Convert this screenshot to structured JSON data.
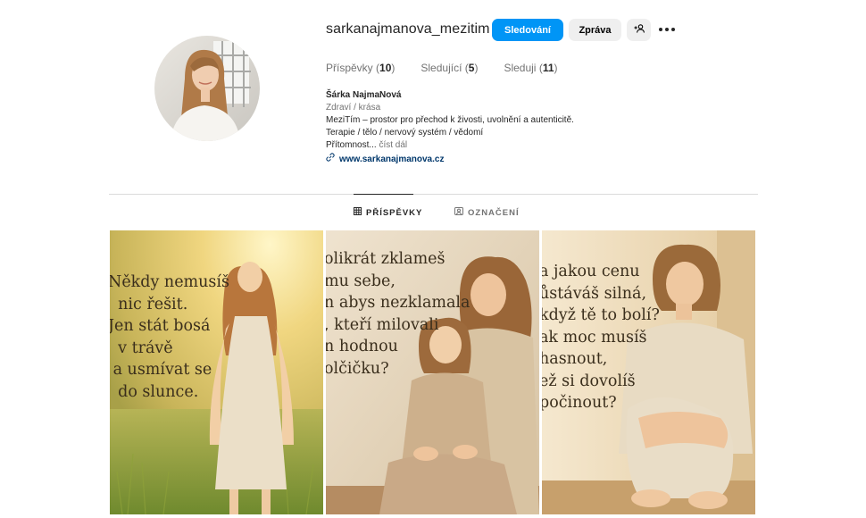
{
  "profile": {
    "username": "sarkanajmanova_mezitim",
    "follow_label": "Sledování",
    "message_label": "Zpráva",
    "stats": [
      {
        "label": "Příspěvky",
        "count": "10"
      },
      {
        "label": "Sledující",
        "count": "5"
      },
      {
        "label": "Sleduji",
        "count": "11"
      }
    ],
    "bio": {
      "name": "Šárka NajmaNová",
      "category": "Zdraví / krása",
      "line1": "MeziTím – prostor pro přechod k živosti, uvolnění a autenticitě.",
      "line2": "Terapie / tělo / nervový systém / vědomí",
      "line3": "Přítomnost...",
      "more": " číst dál",
      "link": "www.sarkanajmanova.cz"
    }
  },
  "tabs": [
    {
      "label": "PŘÍSPĚVKY",
      "active": true
    },
    {
      "label": "OZNAČENÍ",
      "active": false
    }
  ],
  "posts": [
    {
      "text": "Někdy nemusíš\n  nic řešit.\nJen stát bosá\n  v trávě\n a usmívat se\n  do slunce."
    },
    {
      "text": "olikrát zklameš\nmu sebe,\nn abys nezklamala\n, kteří milovali\nn hodnou\nolčičku?"
    },
    {
      "text": "a jakou cenu\nůstáváš silná,\nkdyž tě to bolí?\nak moc musíš\nhasnout,\než si dovolíš\npočinout?"
    }
  ],
  "colors": {
    "accent": "#0095f6",
    "link": "#00376b",
    "muted": "#737373"
  }
}
